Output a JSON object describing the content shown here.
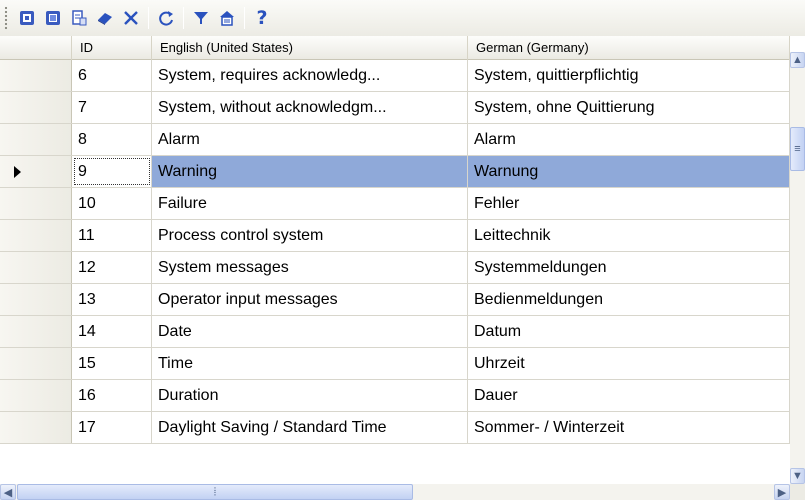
{
  "toolbar": {
    "buttons": [
      {
        "icon": "import-icon"
      },
      {
        "icon": "export-icon"
      },
      {
        "icon": "paste-icon"
      },
      {
        "icon": "eraser-icon"
      },
      {
        "icon": "delete-icon"
      },
      {
        "icon": "refresh-icon"
      },
      {
        "icon": "filter-icon"
      },
      {
        "icon": "properties-icon"
      },
      {
        "icon": "help-icon",
        "glyph": "?"
      }
    ]
  },
  "table": {
    "columns": [
      "ID",
      "English (United States)",
      "German (Germany)"
    ],
    "selected_row": 3,
    "rows": [
      {
        "id": "6",
        "en": "System, requires acknowledg...",
        "de": "System, quittierpflichtig"
      },
      {
        "id": "7",
        "en": "System, without acknowledgm...",
        "de": "System, ohne Quittierung"
      },
      {
        "id": "8",
        "en": "Alarm",
        "de": "Alarm"
      },
      {
        "id": "9",
        "en": "Warning",
        "de": "Warnung"
      },
      {
        "id": "10",
        "en": "Failure",
        "de": "Fehler"
      },
      {
        "id": "11",
        "en": "Process control system",
        "de": "Leittechnik"
      },
      {
        "id": "12",
        "en": "System messages",
        "de": "Systemmeldungen"
      },
      {
        "id": "13",
        "en": "Operator input messages",
        "de": "Bedienmeldungen"
      },
      {
        "id": "14",
        "en": "Date",
        "de": "Datum"
      },
      {
        "id": "15",
        "en": "Time",
        "de": "Uhrzeit"
      },
      {
        "id": "16",
        "en": "Duration",
        "de": "Dauer"
      },
      {
        "id": "17",
        "en": "Daylight Saving / Standard Time",
        "de": "Sommer- / Winterzeit"
      }
    ]
  },
  "colors": {
    "selection": "#8fa9d9",
    "toolbar_icon_blue": "#2a52be",
    "help_yellow": "#e3b700"
  }
}
